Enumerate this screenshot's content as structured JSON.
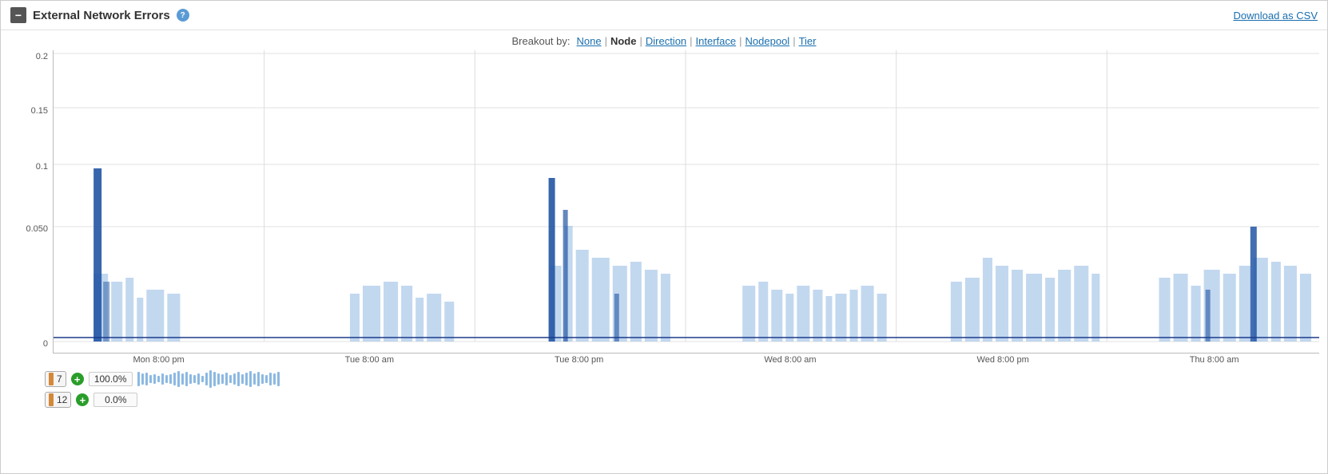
{
  "header": {
    "title": "External Network Errors",
    "collapse_icon": "−",
    "help_icon": "?",
    "download_label": "Download as CSV"
  },
  "breakout": {
    "label": "Breakout by:",
    "options": [
      {
        "label": "None",
        "active": false
      },
      {
        "label": "Node",
        "active": true
      },
      {
        "label": "Direction",
        "active": false
      },
      {
        "label": "Interface",
        "active": false
      },
      {
        "label": "Nodepool",
        "active": false
      },
      {
        "label": "Tier",
        "active": false
      }
    ]
  },
  "chart": {
    "y_labels": [
      "0.2",
      "0.15",
      "0.1",
      "0.050",
      "0"
    ],
    "x_labels": [
      "Mon 8:00 pm",
      "Tue 8:00 am",
      "Tue 8:00 pm",
      "Wed 8:00 am",
      "Wed 8:00 pm",
      "Thu 8:00 am"
    ]
  },
  "legend": [
    {
      "color": "#d4883a",
      "number": "7",
      "percent": "100.0%"
    },
    {
      "color": "#d4883a",
      "number": "12",
      "percent": "0.0%"
    }
  ]
}
